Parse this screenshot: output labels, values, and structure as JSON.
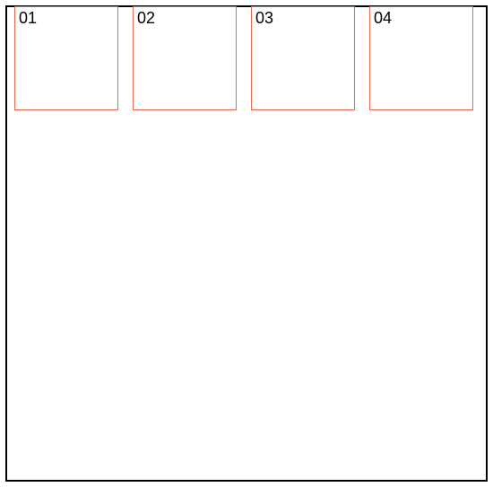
{
  "boxes": [
    {
      "label": "01"
    },
    {
      "label": "02"
    },
    {
      "label": "03"
    },
    {
      "label": "04"
    }
  ]
}
